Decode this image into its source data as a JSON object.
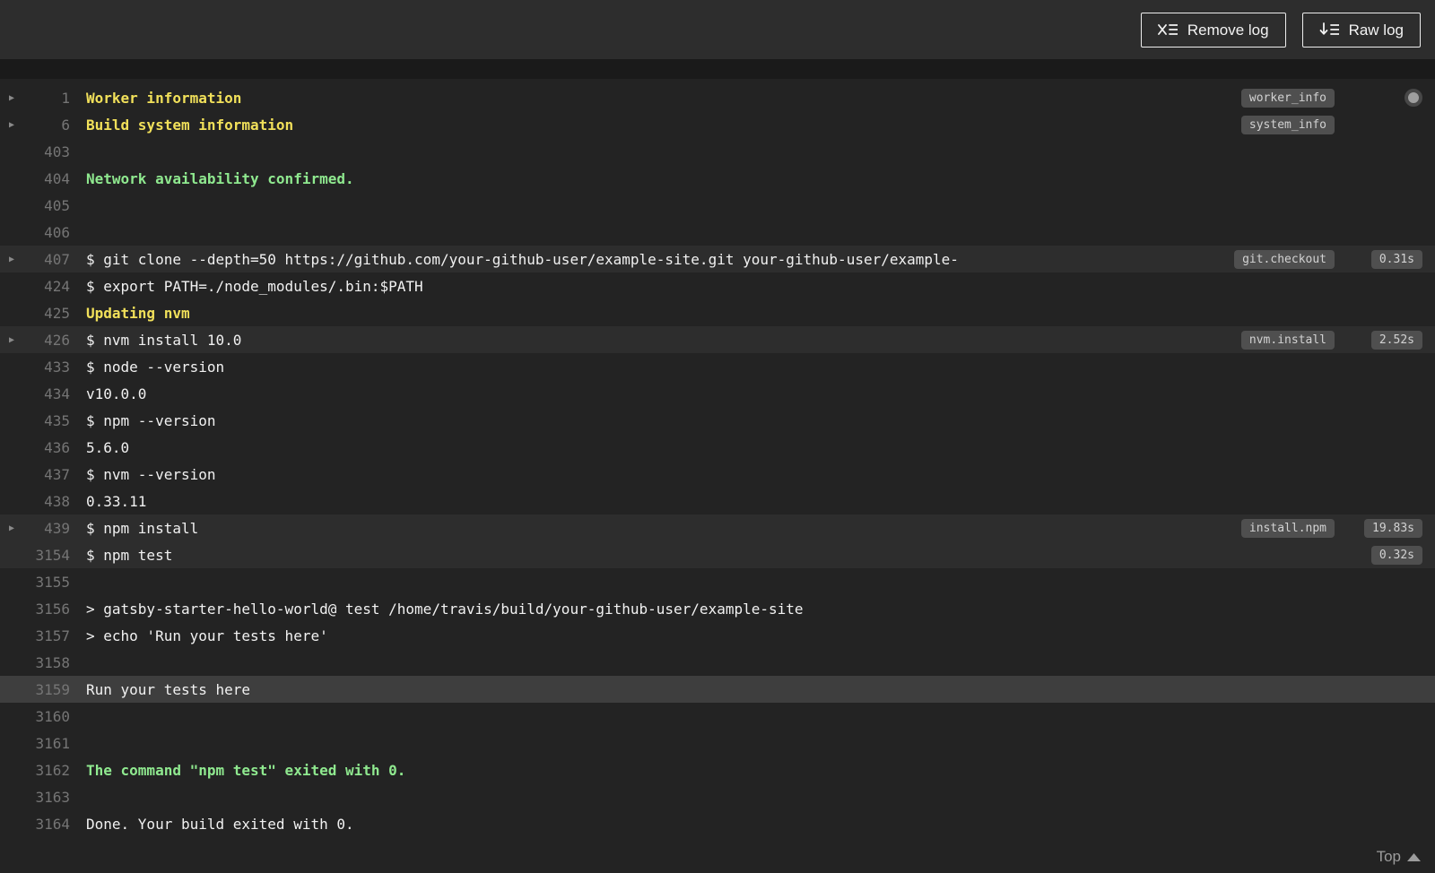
{
  "header": {
    "remove_log_label": "Remove log",
    "raw_log_label": "Raw log"
  },
  "footer": {
    "top_label": "Top"
  },
  "icons": {
    "fold_arrow": "▶"
  },
  "colors": {
    "page_background": "#1a1a1a",
    "header_background": "#2d2d2d",
    "log_background": "#232323",
    "highlight_row": "#2d2d2d",
    "selected_row": "#3e3e3e",
    "badge_background": "#4f4f4f",
    "text": "#f1f1f1",
    "line_number": "#757575",
    "yellow": "#f1e05a",
    "green": "#8fe98f"
  },
  "log": {
    "lines": [
      {
        "num": "1",
        "text": "Worker information",
        "color": "yellow",
        "fold": true,
        "badge": "worker_info",
        "circle": true
      },
      {
        "num": "6",
        "text": "Build system information",
        "color": "yellow",
        "fold": true,
        "badge": "system_info"
      },
      {
        "num": "403",
        "text": ""
      },
      {
        "num": "404",
        "text": "Network availability confirmed.",
        "color": "green"
      },
      {
        "num": "405",
        "text": ""
      },
      {
        "num": "406",
        "text": ""
      },
      {
        "num": "407",
        "text": "$ git clone --depth=50 https://github.com/your-github-user/example-site.git your-github-user/example-",
        "fold": true,
        "badge": "git.checkout",
        "duration": "0.31s",
        "highlight": true
      },
      {
        "num": "424",
        "text": "$ export PATH=./node_modules/.bin:$PATH"
      },
      {
        "num": "425",
        "text": "Updating nvm",
        "color": "yellow"
      },
      {
        "num": "426",
        "text": "$ nvm install 10.0",
        "fold": true,
        "badge": "nvm.install",
        "duration": "2.52s",
        "highlight": true
      },
      {
        "num": "433",
        "text": "$ node --version"
      },
      {
        "num": "434",
        "text": "v10.0.0"
      },
      {
        "num": "435",
        "text": "$ npm --version"
      },
      {
        "num": "436",
        "text": "5.6.0"
      },
      {
        "num": "437",
        "text": "$ nvm --version"
      },
      {
        "num": "438",
        "text": "0.33.11"
      },
      {
        "num": "439",
        "text": "$ npm install",
        "fold": true,
        "badge": "install.npm",
        "duration": "19.83s",
        "highlight": true
      },
      {
        "num": "3154",
        "text": "$ npm test",
        "duration": "0.32s",
        "highlight": true
      },
      {
        "num": "3155",
        "text": ""
      },
      {
        "num": "3156",
        "text": "> gatsby-starter-hello-world@ test /home/travis/build/your-github-user/example-site"
      },
      {
        "num": "3157",
        "text": "> echo 'Run your tests here'"
      },
      {
        "num": "3158",
        "text": ""
      },
      {
        "num": "3159",
        "text": "Run your tests here",
        "selected": true
      },
      {
        "num": "3160",
        "text": ""
      },
      {
        "num": "3161",
        "text": ""
      },
      {
        "num": "3162",
        "text": "The command \"npm test\" exited with 0.",
        "color": "green"
      },
      {
        "num": "3163",
        "text": ""
      },
      {
        "num": "3164",
        "text": "Done. Your build exited with 0."
      }
    ]
  }
}
